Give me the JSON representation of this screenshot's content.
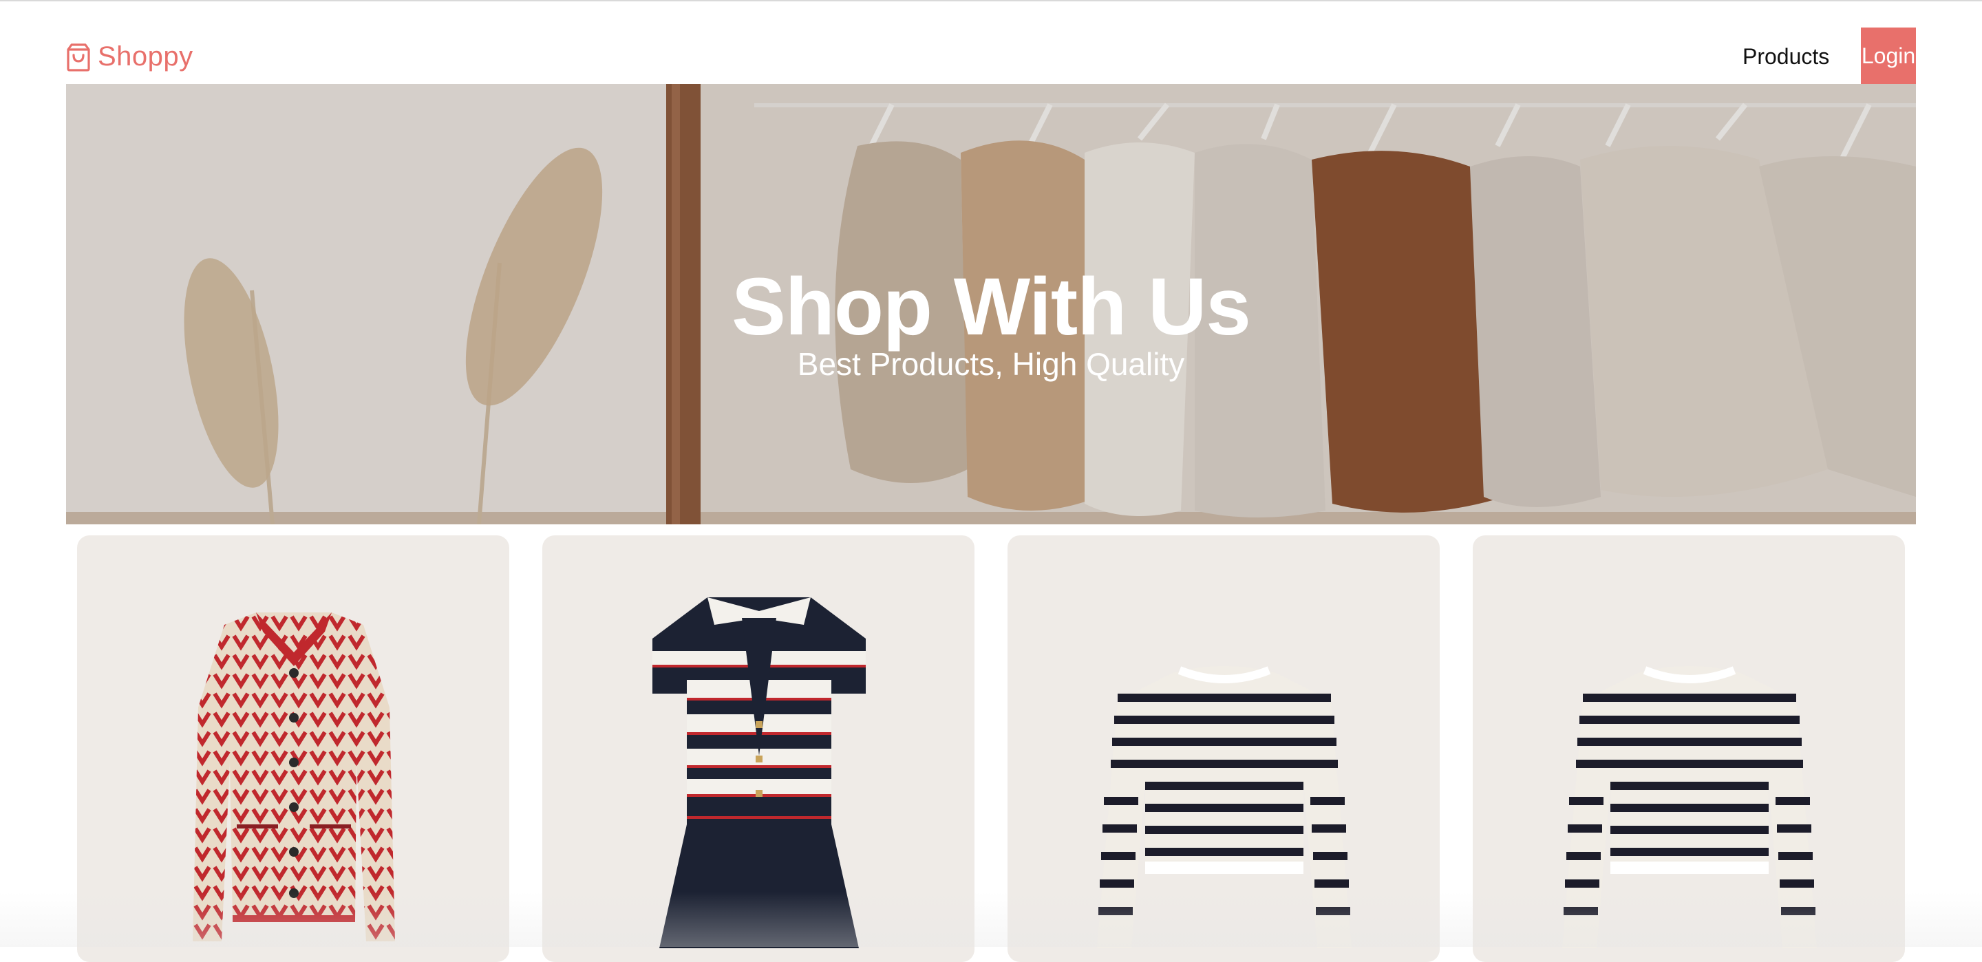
{
  "header": {
    "brand_name": "Shoppy",
    "brand_icon": "shopping-bag-icon",
    "nav_products": "Products",
    "login_label": "Login"
  },
  "hero": {
    "title": "Shop With Us",
    "subtitle": "Best Products, High Quality"
  },
  "products": [
    {
      "image": "red-patterned-jacket"
    },
    {
      "image": "navy-striped-polo-dress"
    },
    {
      "image": "striped-cropped-sweater"
    },
    {
      "image": "striped-cropped-sweater"
    }
  ],
  "colors": {
    "accent": "#e8706b",
    "card_bg": "#efebe7",
    "text": "#111111"
  }
}
